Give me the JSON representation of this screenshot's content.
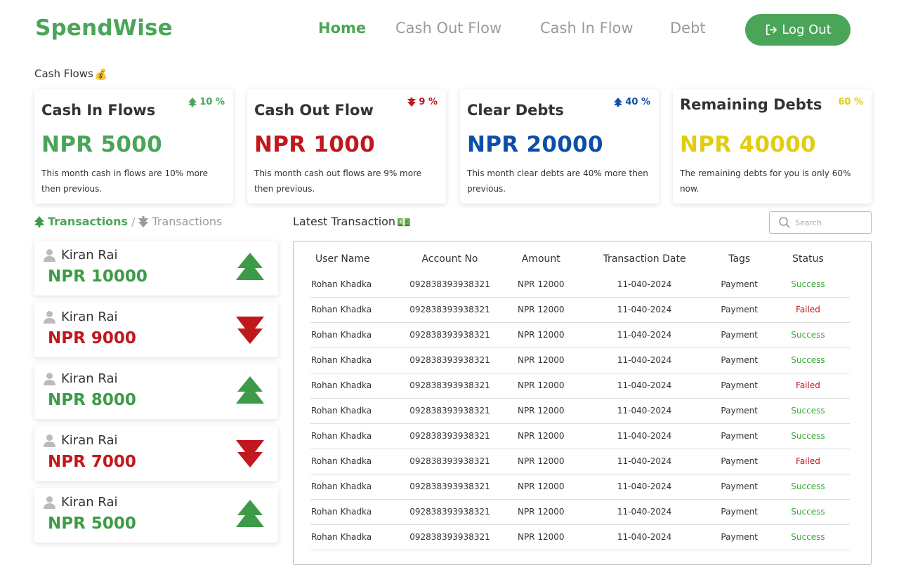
{
  "app": {
    "brand": "SpendWise"
  },
  "nav": [
    {
      "label": "Home",
      "active": true
    },
    {
      "label": "Cash Out Flow",
      "active": false
    },
    {
      "label": "Cash In Flow",
      "active": false
    },
    {
      "label": "Debt",
      "active": false
    }
  ],
  "logout_label": "Log Out",
  "section_label": "Cash Flows",
  "section_emoji": "💰",
  "cards": [
    {
      "title": "Cash In Flows",
      "pct": "10 %",
      "pct_dir": "up",
      "amount": "NPR 5000",
      "desc": "This month cash in flows are 10% more then previous.",
      "color": "#4aa558"
    },
    {
      "title": "Cash Out Flow",
      "pct": "9 %",
      "pct_dir": "down",
      "amount": "NPR 1000",
      "desc": "This month cash out flows are 9% more then previous.",
      "color": "#c0181d"
    },
    {
      "title": "Clear Debts",
      "pct": "40 %",
      "pct_dir": "up",
      "amount": "NPR 20000",
      "desc": "This month clear debts are 40% more then previous.",
      "color": "#0d4fa8"
    },
    {
      "title": "Remaining Debts",
      "pct": "60 %",
      "pct_dir": "none",
      "amount": "NPR 40000",
      "desc": "The remaining debts for you is only 60% now.",
      "color": "#e3cc10"
    }
  ],
  "tx_toggle": {
    "in_label": "Transactions",
    "separator": "/",
    "out_label": "Transactions"
  },
  "transactions": [
    {
      "name": "Kiran Rai",
      "amount": "NPR 10000",
      "dir": "up"
    },
    {
      "name": "Kiran Rai",
      "amount": "NPR 9000",
      "dir": "down"
    },
    {
      "name": "Kiran Rai",
      "amount": "NPR 8000",
      "dir": "up"
    },
    {
      "name": "Kiran Rai",
      "amount": "NPR 7000",
      "dir": "down"
    },
    {
      "name": "Kiran Rai",
      "amount": "NPR 5000",
      "dir": "up"
    }
  ],
  "latest": {
    "title": "Latest Transaction",
    "emoji": "💵",
    "search_placeholder": "Search"
  },
  "table": {
    "headers": [
      "User Name",
      "Account No",
      "Amount",
      "Transaction Date",
      "Tags",
      "Status"
    ],
    "rows": [
      [
        "Rohan Khadka",
        "092838393938321",
        "NPR 12000",
        "11-040-2024",
        "Payment",
        "Success"
      ],
      [
        "Rohan Khadka",
        "092838393938321",
        "NPR 12000",
        "11-040-2024",
        "Payment",
        "Failed"
      ],
      [
        "Rohan Khadka",
        "092838393938321",
        "NPR 12000",
        "11-040-2024",
        "Payment",
        "Success"
      ],
      [
        "Rohan Khadka",
        "092838393938321",
        "NPR 12000",
        "11-040-2024",
        "Payment",
        "Success"
      ],
      [
        "Rohan Khadka",
        "092838393938321",
        "NPR 12000",
        "11-040-2024",
        "Payment",
        "Failed"
      ],
      [
        "Rohan Khadka",
        "092838393938321",
        "NPR 12000",
        "11-040-2024",
        "Payment",
        "Success"
      ],
      [
        "Rohan Khadka",
        "092838393938321",
        "NPR 12000",
        "11-040-2024",
        "Payment",
        "Success"
      ],
      [
        "Rohan Khadka",
        "092838393938321",
        "NPR 12000",
        "11-040-2024",
        "Payment",
        "Failed"
      ],
      [
        "Rohan Khadka",
        "092838393938321",
        "NPR 12000",
        "11-040-2024",
        "Payment",
        "Success"
      ],
      [
        "Rohan Khadka",
        "092838393938321",
        "NPR 12000",
        "11-040-2024",
        "Payment",
        "Success"
      ],
      [
        "Rohan Khadka",
        "092838393938321",
        "NPR 12000",
        "11-040-2024",
        "Payment",
        "Success"
      ]
    ]
  },
  "colors": {
    "brand": "#4aa558",
    "nav_inactive": "#9a9a9a",
    "up": "#3d9b47",
    "down": "#c0181d",
    "success": "#3ea83e",
    "failed": "#c0181d"
  }
}
